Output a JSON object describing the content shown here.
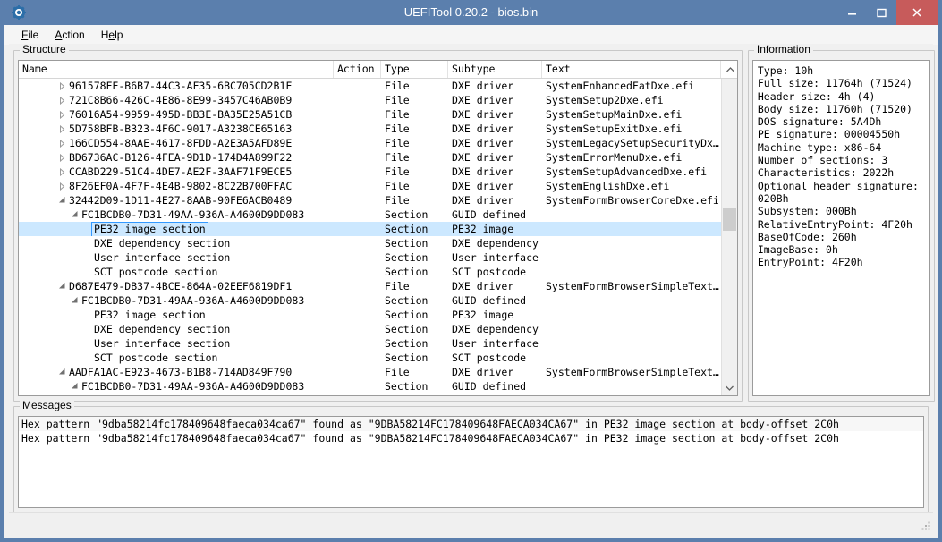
{
  "window": {
    "title": "UEFITool 0.20.2 - bios.bin",
    "app_icon": "uefitool-gear-icon",
    "minimize_label": "Minimize",
    "maximize_label": "Maximize",
    "close_label": "Close",
    "accent_color": "#5b7fad",
    "close_color": "#c75b5b",
    "selection_color": "#cce8ff"
  },
  "menubar": {
    "items": [
      {
        "label": "File",
        "mnemonic": "F"
      },
      {
        "label": "Action",
        "mnemonic": "A"
      },
      {
        "label": "Help",
        "mnemonic": "H"
      }
    ]
  },
  "structure": {
    "title": "Structure",
    "columns": [
      "Name",
      "Action",
      "Type",
      "Subtype",
      "Text"
    ],
    "rows": [
      {
        "indent": 3,
        "twisty": "collapsed",
        "name": "961578FE-B6B7-44C3-AF35-6BC705CD2B1F",
        "action": "",
        "type": "File",
        "subtype": "DXE driver",
        "text": "SystemEnhancedFatDxe.efi",
        "selected": false
      },
      {
        "indent": 3,
        "twisty": "collapsed",
        "name": "721C8B66-426C-4E86-8E99-3457C46AB0B9",
        "action": "",
        "type": "File",
        "subtype": "DXE driver",
        "text": "SystemSetup2Dxe.efi",
        "selected": false
      },
      {
        "indent": 3,
        "twisty": "collapsed",
        "name": "76016A54-9959-495D-BB3E-BA35E25A51CB",
        "action": "",
        "type": "File",
        "subtype": "DXE driver",
        "text": "SystemSetupMainDxe.efi",
        "selected": false
      },
      {
        "indent": 3,
        "twisty": "collapsed",
        "name": "5D758BFB-B323-4F6C-9017-A3238CE65163",
        "action": "",
        "type": "File",
        "subtype": "DXE driver",
        "text": "SystemSetupExitDxe.efi",
        "selected": false
      },
      {
        "indent": 3,
        "twisty": "collapsed",
        "name": "166CD554-8AAE-4617-8FDD-A2E3A5AFD89E",
        "action": "",
        "type": "File",
        "subtype": "DXE driver",
        "text": "SystemLegacySetupSecurityDx…",
        "selected": false
      },
      {
        "indent": 3,
        "twisty": "collapsed",
        "name": "BD6736AC-B126-4FEA-9D1D-174D4A899F22",
        "action": "",
        "type": "File",
        "subtype": "DXE driver",
        "text": "SystemErrorMenuDxe.efi",
        "selected": false
      },
      {
        "indent": 3,
        "twisty": "collapsed",
        "name": "CCABD229-51C4-4DE7-AE2F-3AAF71F9ECE5",
        "action": "",
        "type": "File",
        "subtype": "DXE driver",
        "text": "SystemSetupAdvancedDxe.efi",
        "selected": false
      },
      {
        "indent": 3,
        "twisty": "collapsed",
        "name": "8F26EF0A-4F7F-4E4B-9802-8C22B700FFAC",
        "action": "",
        "type": "File",
        "subtype": "DXE driver",
        "text": "SystemEnglishDxe.efi",
        "selected": false
      },
      {
        "indent": 3,
        "twisty": "expanded",
        "name": "32442D09-1D11-4E27-8AAB-90FE6ACB0489",
        "action": "",
        "type": "File",
        "subtype": "DXE driver",
        "text": "SystemFormBrowserCoreDxe.efi",
        "selected": false
      },
      {
        "indent": 4,
        "twisty": "expanded",
        "name": "FC1BCDB0-7D31-49AA-936A-A4600D9DD083",
        "action": "",
        "type": "Section",
        "subtype": "GUID defined",
        "text": "",
        "selected": false
      },
      {
        "indent": 5,
        "twisty": "none",
        "name": "PE32 image section",
        "action": "",
        "type": "Section",
        "subtype": "PE32 image",
        "text": "",
        "selected": true
      },
      {
        "indent": 5,
        "twisty": "none",
        "name": "DXE dependency section",
        "action": "",
        "type": "Section",
        "subtype": "DXE dependency",
        "text": "",
        "selected": false
      },
      {
        "indent": 5,
        "twisty": "none",
        "name": "User interface section",
        "action": "",
        "type": "Section",
        "subtype": "User interface",
        "text": "",
        "selected": false
      },
      {
        "indent": 5,
        "twisty": "none",
        "name": "SCT postcode section",
        "action": "",
        "type": "Section",
        "subtype": "SCT postcode",
        "text": "",
        "selected": false
      },
      {
        "indent": 3,
        "twisty": "expanded",
        "name": "D687E479-DB37-4BCE-864A-02EEF6819DF1",
        "action": "",
        "type": "File",
        "subtype": "DXE driver",
        "text": "SystemFormBrowserSimpleText…",
        "selected": false
      },
      {
        "indent": 4,
        "twisty": "expanded",
        "name": "FC1BCDB0-7D31-49AA-936A-A4600D9DD083",
        "action": "",
        "type": "Section",
        "subtype": "GUID defined",
        "text": "",
        "selected": false
      },
      {
        "indent": 5,
        "twisty": "none",
        "name": "PE32 image section",
        "action": "",
        "type": "Section",
        "subtype": "PE32 image",
        "text": "",
        "selected": false
      },
      {
        "indent": 5,
        "twisty": "none",
        "name": "DXE dependency section",
        "action": "",
        "type": "Section",
        "subtype": "DXE dependency",
        "text": "",
        "selected": false
      },
      {
        "indent": 5,
        "twisty": "none",
        "name": "User interface section",
        "action": "",
        "type": "Section",
        "subtype": "User interface",
        "text": "",
        "selected": false
      },
      {
        "indent": 5,
        "twisty": "none",
        "name": "SCT postcode section",
        "action": "",
        "type": "Section",
        "subtype": "SCT postcode",
        "text": "",
        "selected": false
      },
      {
        "indent": 3,
        "twisty": "expanded",
        "name": "AADFA1AC-E923-4673-B1B8-714AD849F790",
        "action": "",
        "type": "File",
        "subtype": "DXE driver",
        "text": "SystemFormBrowserSimpleText…",
        "selected": false
      },
      {
        "indent": 4,
        "twisty": "expanded",
        "name": "FC1BCDB0-7D31-49AA-936A-A4600D9DD083",
        "action": "",
        "type": "Section",
        "subtype": "GUID defined",
        "text": "",
        "selected": false
      }
    ],
    "scrollbar": {
      "up_arrow": "chevron-up-icon",
      "down_arrow": "chevron-down-icon"
    }
  },
  "information": {
    "title": "Information",
    "lines": [
      "Type: 10h",
      "Full size: 11764h (71524)",
      "Header size: 4h (4)",
      "Body size: 11760h (71520)",
      "DOS signature: 5A4Dh",
      "PE signature: 00004550h",
      "Machine type: x86-64",
      "Number of sections: 3",
      "Characteristics: 2022h",
      "Optional header signature: 020Bh",
      "Subsystem: 000Bh",
      "RelativeEntryPoint: 4F20h",
      "BaseOfCode: 260h",
      "ImageBase: 0h",
      "EntryPoint: 4F20h"
    ]
  },
  "messages": {
    "title": "Messages",
    "rows": [
      "Hex pattern \"9dba58214fc178409648faeca034ca67\" found as \"9DBA58214FC178409648FAECA034CA67\" in PE32 image section at body-offset 2C0h",
      "Hex pattern \"9dba58214fc178409648faeca034ca67\" found as \"9DBA58214FC178409648FAECA034CA67\" in PE32 image section at body-offset 2C0h"
    ]
  },
  "statusbar": {
    "text": "",
    "grip": "resize-grip-icon"
  }
}
